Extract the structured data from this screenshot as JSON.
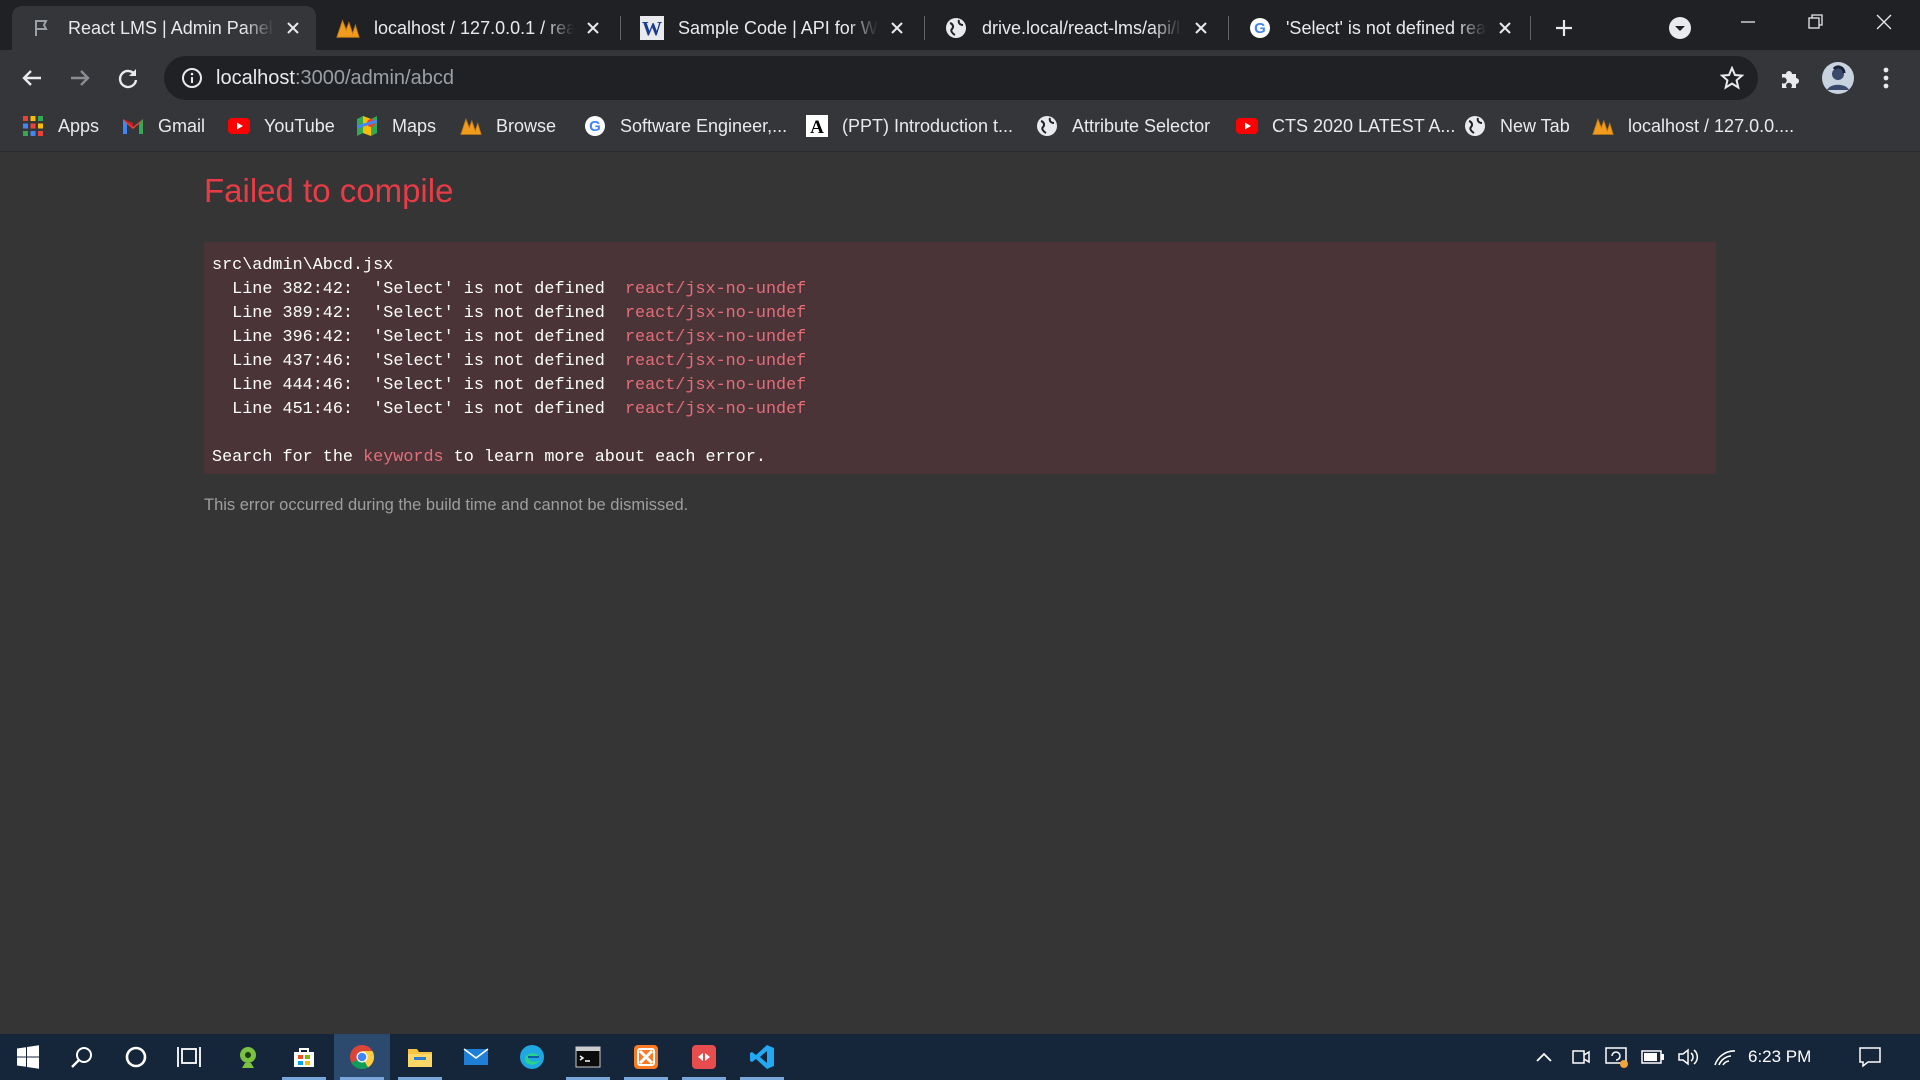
{
  "browser": {
    "tabs": [
      {
        "title": "React LMS | Admin Panel",
        "active": true,
        "favicon": "react-lms-favicon"
      },
      {
        "title": "localhost / 127.0.0.1 / react",
        "active": false,
        "favicon": "phpmyadmin-icon"
      },
      {
        "title": "Sample Code | API for Wiz",
        "active": false,
        "favicon": "word-w-icon"
      },
      {
        "title": "drive.local/react-lms/api/l",
        "active": false,
        "favicon": "globe-icon"
      },
      {
        "title": "'Select' is not defined react",
        "active": false,
        "favicon": "google-icon"
      }
    ],
    "address": {
      "host": "localhost",
      "rest": ":3000/admin/abcd"
    },
    "bookmarks": [
      {
        "label": "Apps",
        "icon": "apps-grid-icon"
      },
      {
        "label": "Gmail",
        "icon": "gmail-icon"
      },
      {
        "label": "YouTube",
        "icon": "youtube-icon"
      },
      {
        "label": "Maps",
        "icon": "maps-icon"
      },
      {
        "label": "Browse",
        "icon": "phpmyadmin-icon"
      },
      {
        "label": "Software Engineer,...",
        "icon": "google-icon"
      },
      {
        "label": "(PPT) Introduction t...",
        "icon": "academia-icon"
      },
      {
        "label": "Attribute Selector",
        "icon": "globe-icon"
      },
      {
        "label": "CTS 2020 LATEST A...",
        "icon": "youtube-icon"
      },
      {
        "label": "New Tab",
        "icon": "globe-icon"
      },
      {
        "label": "localhost / 127.0.0....",
        "icon": "phpmyadmin-icon"
      }
    ]
  },
  "error": {
    "title": "Failed to compile",
    "file": "src\\admin\\Abcd.jsx",
    "lines": [
      {
        "location": "Line 382:42:",
        "message": "'Select' is not defined",
        "rule": "react/jsx-no-undef"
      },
      {
        "location": "Line 389:42:",
        "message": "'Select' is not defined",
        "rule": "react/jsx-no-undef"
      },
      {
        "location": "Line 396:42:",
        "message": "'Select' is not defined",
        "rule": "react/jsx-no-undef"
      },
      {
        "location": "Line 437:46:",
        "message": "'Select' is not defined",
        "rule": "react/jsx-no-undef"
      },
      {
        "location": "Line 444:46:",
        "message": "'Select' is not defined",
        "rule": "react/jsx-no-undef"
      },
      {
        "location": "Line 451:46:",
        "message": "'Select' is not defined",
        "rule": "react/jsx-no-undef"
      }
    ],
    "hint_prefix": "Search for the ",
    "hint_keyword": "keywords",
    "hint_suffix": " to learn more about each error.",
    "footer": "This error occurred during the build time and cannot be dismissed."
  },
  "taskbar": {
    "clock": "6:23 PM",
    "apps": [
      "start-icon",
      "search-icon",
      "cortana-icon",
      "task-view-icon",
      "greenshot-icon",
      "store-icon",
      "chrome-icon",
      "file-explorer-icon",
      "mail-icon",
      "edge-icon",
      "terminal-icon",
      "xampp-icon",
      "postman-icon",
      "vscode-icon"
    ]
  },
  "colors": {
    "error_title": "#e83b46",
    "error_box_bg": "#4a3437",
    "rule_text": "#e36e7a",
    "page_bg": "#353535"
  }
}
